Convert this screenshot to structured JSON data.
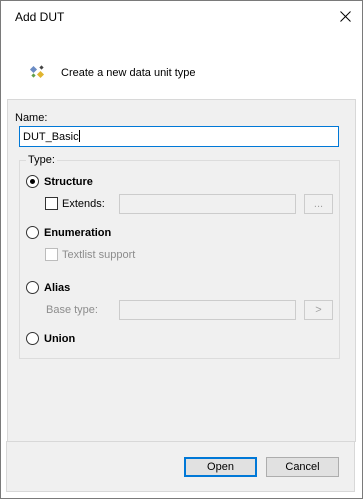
{
  "window": {
    "title": "Add DUT"
  },
  "header": {
    "icon": "dut-type-icon",
    "text": "Create a new data unit type"
  },
  "name": {
    "label": "Name:",
    "value": "DUT_Basic"
  },
  "type_group": {
    "legend": "Type:",
    "structure": {
      "label": "Structure",
      "selected": true
    },
    "extends": {
      "label": "Extends:",
      "checked": false,
      "value": "",
      "browse_label": "..."
    },
    "enumeration": {
      "label": "Enumeration",
      "selected": false
    },
    "textlist": {
      "label": "Textlist support",
      "checked": false,
      "enabled": false
    },
    "alias": {
      "label": "Alias",
      "selected": false
    },
    "base_type": {
      "label": "Base type:",
      "value": "",
      "browse_label": ">"
    },
    "union": {
      "label": "Union",
      "selected": false
    }
  },
  "buttons": {
    "open": "Open",
    "cancel": "Cancel"
  }
}
